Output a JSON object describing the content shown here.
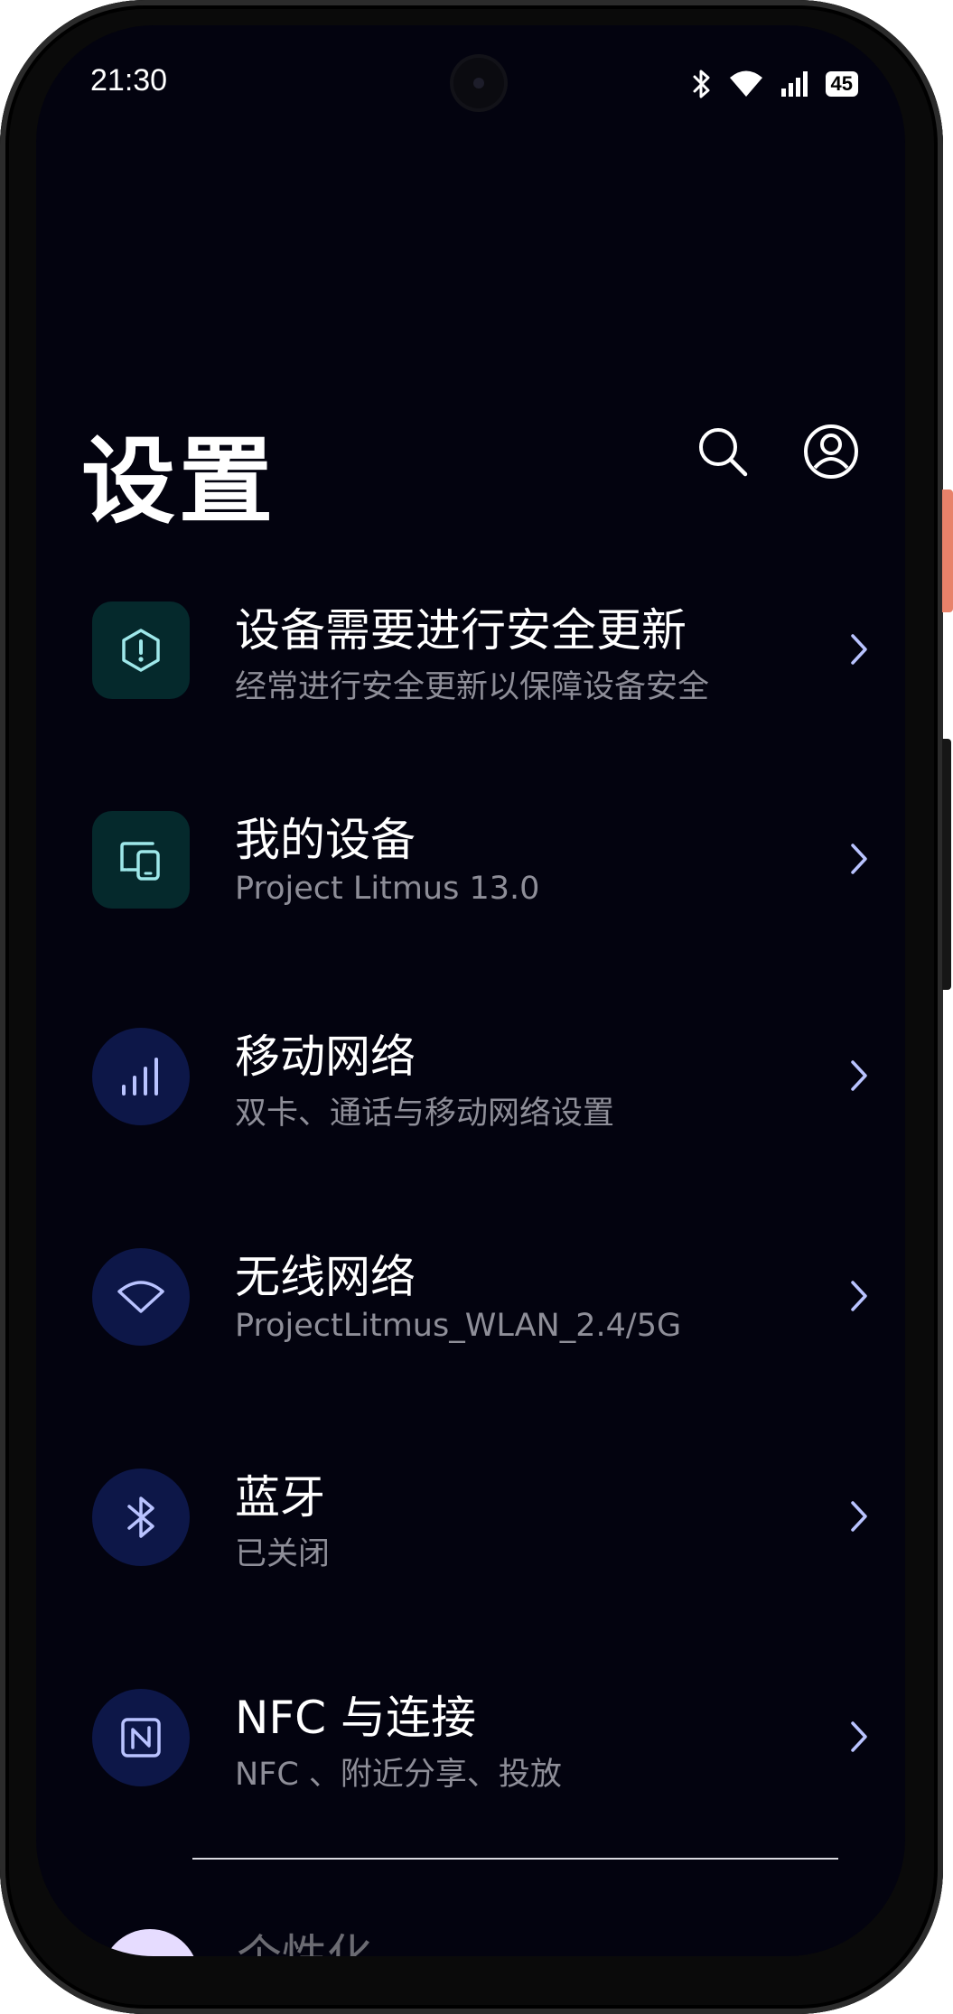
{
  "status_bar": {
    "time": "21:30",
    "battery": "45",
    "icons": [
      "bluetooth-icon",
      "wifi-icon",
      "signal-icon",
      "battery-icon"
    ]
  },
  "header": {
    "title": "设置",
    "actions": [
      "search-icon",
      "account-icon"
    ]
  },
  "items": [
    {
      "title": "设备需要进行安全更新",
      "subtitle": "经常进行安全更新以保障设备安全",
      "icon": "shield-alert-icon",
      "icon_color": "#9ee8ea"
    },
    {
      "title": "我的设备",
      "subtitle": "Project Litmus 13.0",
      "icon": "devices-icon",
      "icon_color": "#9ee8ea"
    },
    {
      "title": "移动网络",
      "subtitle": "双卡、通话与移动网络设置",
      "icon": "cellular-icon",
      "icon_color": "#b9c3ff"
    },
    {
      "title": "无线网络",
      "subtitle": "ProjectLitmus_WLAN_2.4/5G",
      "icon": "wifi-icon",
      "icon_color": "#b9c3ff"
    },
    {
      "title": "蓝牙",
      "subtitle": "已关闭",
      "icon": "bluetooth-icon",
      "icon_color": "#b9c3ff"
    },
    {
      "title": "NFC 与连接",
      "subtitle": "NFC 、附近分享、投放",
      "icon": "nfc-icon",
      "icon_color": "#b9c3ff"
    }
  ],
  "peek_item": {
    "title": "个性化"
  },
  "colors": {
    "background": "#03030f",
    "teal_tile": "#05292c",
    "blue_tile": "#0d1748",
    "chevron": "#b9c3ff",
    "frame_accent": "#e8826a"
  }
}
